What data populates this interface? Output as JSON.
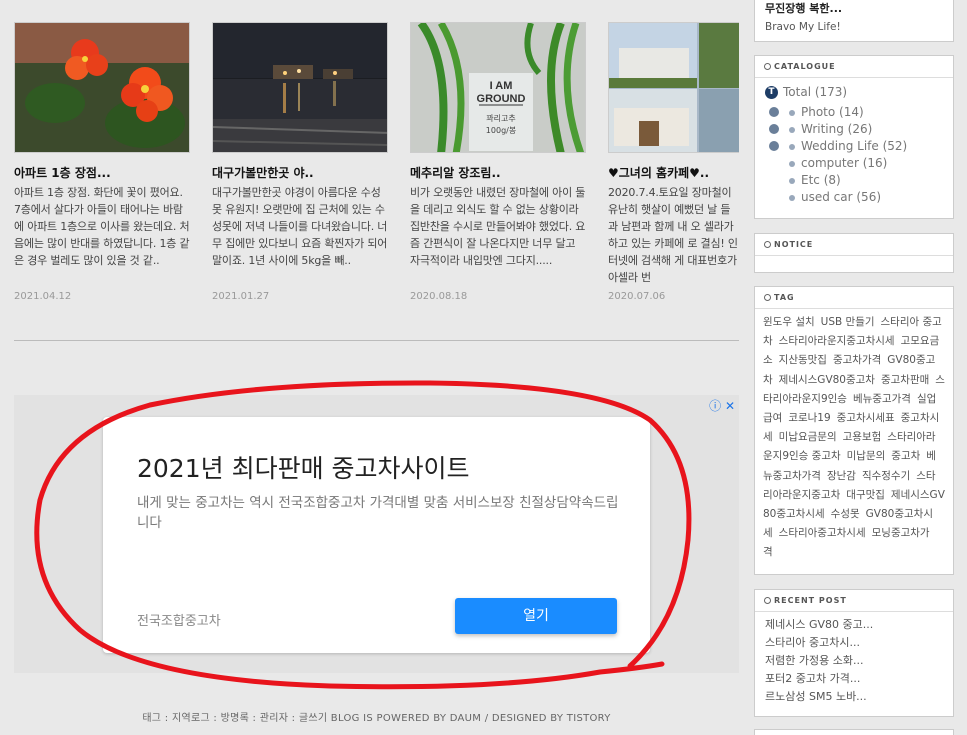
{
  "posts": [
    {
      "title": "아파트 1층 장점...",
      "excerpt": "아파트 1층 장점. 화단에 꽃이 폈어요. 7층에서 살다가 아들이 태어나는 바람에 아파트 1층으로 이사를 왔는데요. 처음에는 많이 반대를 하였답니다. 1층 같은 경우 벌레도 많이 있을 것 같..",
      "date": "2021.04.12"
    },
    {
      "title": "대구가볼만한곳 야..",
      "excerpt": "대구가볼만한곳 야경이 아름다운 수성못 유원지! 오랫만에 집 근처에 있는 수성못에 저녁 나들이를 다녀왔습니다. 너무 집에만 있다보니 요즘 확찐자가 되어 말이죠. 1년 사이에 5kg을 빼..",
      "date": "2021.01.27"
    },
    {
      "title": "메추리알 장조림..",
      "excerpt": "비가 오랫동안 내렸던 장마철에 아이 둘을 데리고 외식도 할 수 없는 상황이라 집반찬을 수시로 만들어봐야 했었다. 요즘 간편식이 잘 나온다지만 너무 달고 자극적이라 내입맛엔 그다지.....",
      "date": "2020.08.18"
    },
    {
      "title": "♥그녀의 홈카페♥..",
      "excerpt": "2020.7.4.토요일 장마철이 유난히 햇살이 예뻤던 날 들과 남편과 함께 내 오 셀라가 하고 있는 카페에 로 결심! 인터넷에 검색해 게 대표번호가 아셀라 번",
      "date": "2020.07.06"
    }
  ],
  "thumb_text": {
    "i_am": "I AM",
    "ground": "GROUND",
    "product": "꽈리고추",
    "weight": "100g/봉"
  },
  "ad": {
    "headline": "2021년 최다판매 중고차사이트",
    "description": "내게 맞는 중고차는 역시 전국조합중고차 가격대별 맞춤 서비스보장 친절상담약속드립니다",
    "advertiser": "전국조합중고차",
    "button": "열기",
    "icons": "ⓘ ✕"
  },
  "footer": "태그 : 지역로그 : 방명록 : 관리자 : 글쓰기      BLOG IS POWERED BY DAUM / DESIGNED BY TISTORY",
  "sidebar": {
    "top_title": "무진장행 복한...",
    "top_sub": "Bravo My Life!",
    "catalogue_title": "CATALOGUE",
    "total": "Total (173)",
    "categories": [
      "Photo (14)",
      "Writing (26)",
      "Wedding Life (52)",
      "computer (16)",
      "Etc (8)",
      "used car (56)"
    ],
    "notice_title": "NOTICE",
    "tag_title": "TAG",
    "tags": [
      "윈도우 설치",
      "USB 만들기",
      "스타리아 중고차",
      "스타리아라운지중고차시세",
      "고모요금소",
      "지산동맛집",
      "중고차가격",
      "GV80중고차",
      "제네시스GV80중고차",
      "중고차판매",
      "스타리아라운지9인승",
      "베뉴중고가격",
      "실업급여",
      "코로나19",
      "중고차시세표",
      "중고차시세",
      "미납요금문의",
      "고용보험",
      "스타리아라운지9인승 중고차",
      "미납문의",
      "중고차",
      "베뉴중고차가격",
      "장난감",
      "직수정수기",
      "스타리아라운지중고차",
      "대구맛집",
      "제네시스GV80중고차시세",
      "수성못",
      "GV80중고차시세",
      "스타리아중고차시세",
      "모닝중고차가격"
    ],
    "recent_title": "RECENT POST",
    "recent": [
      "제네시스 GV80 중고...",
      "스타리아 중고차시...",
      "저렴한 가정용 소화...",
      "포터2 중고차 가격...",
      "르노삼성 SM5 노바..."
    ]
  },
  "colors": {
    "accent_button": "#1a8cff",
    "scribble": "#e8141c",
    "background": "#e9e9e9"
  }
}
